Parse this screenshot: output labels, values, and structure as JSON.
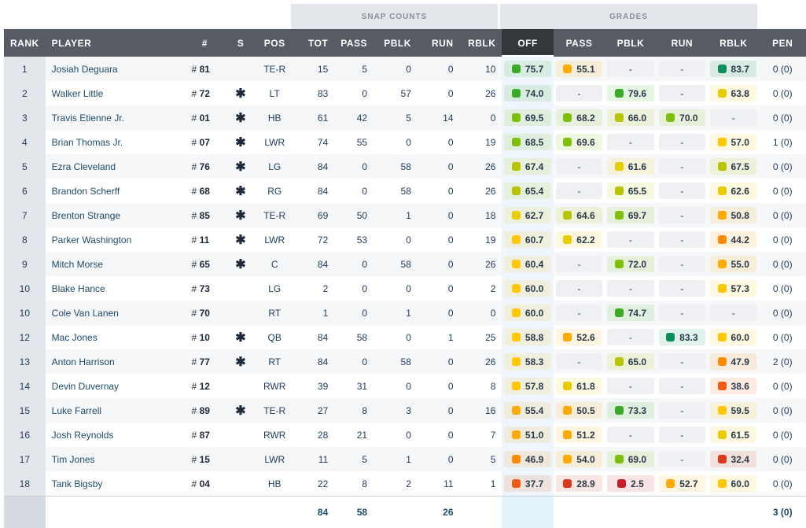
{
  "groups": {
    "snap_counts": "SNAP COUNTS",
    "grades": "GRADES"
  },
  "columns": {
    "rank": "RANK",
    "player": "PLAYER",
    "number": "#",
    "starter": "S",
    "pos": "POS",
    "tot": "TOT",
    "pass": "PASS",
    "pblk": "PBLK",
    "run": "RUN",
    "rblk": "RBLK",
    "g_off": "OFF",
    "g_pass": "PASS",
    "g_pblk": "PBLK",
    "g_run": "RUN",
    "g_rblk": "RBLK",
    "pen": "PEN"
  },
  "grade_colors": {
    "dark_green": "#0a8f5a",
    "green": "#3aab25",
    "lime": "#7dbf0a",
    "yellow_green": "#b9c400",
    "yellow": "#e8cc00",
    "gold": "#ffc800",
    "amber": "#ffaa00",
    "orange": "#ff8a00",
    "red_orange": "#f15a10",
    "red": "#d83a1a",
    "dark_red": "#c81e2a"
  },
  "rows": [
    {
      "rank": "1",
      "player": "Josiah Deguara",
      "num_prefix": "# ",
      "num": "81",
      "s": "",
      "pos": "TE-R",
      "tot": "15",
      "pass": "5",
      "pblk": "0",
      "run": "0",
      "rblk": "10",
      "off": "75.7",
      "g_pass": "55.1",
      "g_pblk": "-",
      "g_run": "-",
      "g_rblk": "83.7",
      "pen": "0 (0)"
    },
    {
      "rank": "2",
      "player": "Walker Little",
      "num_prefix": "# ",
      "num": "72",
      "s": "✱",
      "pos": "LT",
      "tot": "83",
      "pass": "0",
      "pblk": "57",
      "run": "0",
      "rblk": "26",
      "off": "74.0",
      "g_pass": "-",
      "g_pblk": "79.6",
      "g_run": "-",
      "g_rblk": "63.8",
      "pen": "0 (0)"
    },
    {
      "rank": "3",
      "player": "Travis Etienne Jr.",
      "num_prefix": "# ",
      "num": "01",
      "s": "✱",
      "pos": "HB",
      "tot": "61",
      "pass": "42",
      "pblk": "5",
      "run": "14",
      "rblk": "0",
      "off": "69.5",
      "g_pass": "68.2",
      "g_pblk": "66.0",
      "g_run": "70.0",
      "g_rblk": "-",
      "pen": "0 (0)"
    },
    {
      "rank": "4",
      "player": "Brian Thomas Jr.",
      "num_prefix": "# ",
      "num": "07",
      "s": "✱",
      "pos": "LWR",
      "tot": "74",
      "pass": "55",
      "pblk": "0",
      "run": "0",
      "rblk": "19",
      "off": "68.5",
      "g_pass": "69.6",
      "g_pblk": "-",
      "g_run": "-",
      "g_rblk": "57.0",
      "pen": "1 (0)"
    },
    {
      "rank": "5",
      "player": "Ezra Cleveland",
      "num_prefix": "# ",
      "num": "76",
      "s": "✱",
      "pos": "LG",
      "tot": "84",
      "pass": "0",
      "pblk": "58",
      "run": "0",
      "rblk": "26",
      "off": "67.4",
      "g_pass": "-",
      "g_pblk": "61.6",
      "g_run": "-",
      "g_rblk": "67.5",
      "pen": "0 (0)"
    },
    {
      "rank": "6",
      "player": "Brandon Scherff",
      "num_prefix": "# ",
      "num": "68",
      "s": "✱",
      "pos": "RG",
      "tot": "84",
      "pass": "0",
      "pblk": "58",
      "run": "0",
      "rblk": "26",
      "off": "65.4",
      "g_pass": "-",
      "g_pblk": "65.5",
      "g_run": "-",
      "g_rblk": "62.6",
      "pen": "0 (0)"
    },
    {
      "rank": "7",
      "player": "Brenton Strange",
      "num_prefix": "# ",
      "num": "85",
      "s": "✱",
      "pos": "TE-R",
      "tot": "69",
      "pass": "50",
      "pblk": "1",
      "run": "0",
      "rblk": "18",
      "off": "62.7",
      "g_pass": "64.6",
      "g_pblk": "69.7",
      "g_run": "-",
      "g_rblk": "50.8",
      "pen": "0 (0)"
    },
    {
      "rank": "8",
      "player": "Parker Washington",
      "num_prefix": "# ",
      "num": "11",
      "s": "✱",
      "pos": "LWR",
      "tot": "72",
      "pass": "53",
      "pblk": "0",
      "run": "0",
      "rblk": "19",
      "off": "60.7",
      "g_pass": "62.2",
      "g_pblk": "-",
      "g_run": "-",
      "g_rblk": "44.2",
      "pen": "0 (0)"
    },
    {
      "rank": "9",
      "player": "Mitch Morse",
      "num_prefix": "# ",
      "num": "65",
      "s": "✱",
      "pos": "C",
      "tot": "84",
      "pass": "0",
      "pblk": "58",
      "run": "0",
      "rblk": "26",
      "off": "60.4",
      "g_pass": "-",
      "g_pblk": "72.0",
      "g_run": "-",
      "g_rblk": "55.0",
      "pen": "0 (0)"
    },
    {
      "rank": "10",
      "player": "Blake Hance",
      "num_prefix": "# ",
      "num": "73",
      "s": "",
      "pos": "LG",
      "tot": "2",
      "pass": "0",
      "pblk": "0",
      "run": "0",
      "rblk": "2",
      "off": "60.0",
      "g_pass": "-",
      "g_pblk": "-",
      "g_run": "-",
      "g_rblk": "57.3",
      "pen": "0 (0)"
    },
    {
      "rank": "10",
      "player": "Cole Van Lanen",
      "num_prefix": "# ",
      "num": "70",
      "s": "",
      "pos": "RT",
      "tot": "1",
      "pass": "0",
      "pblk": "1",
      "run": "0",
      "rblk": "0",
      "off": "60.0",
      "g_pass": "-",
      "g_pblk": "74.7",
      "g_run": "-",
      "g_rblk": "-",
      "pen": "0 (0)"
    },
    {
      "rank": "12",
      "player": "Mac Jones",
      "num_prefix": "# ",
      "num": "10",
      "s": "✱",
      "pos": "QB",
      "tot": "84",
      "pass": "58",
      "pblk": "0",
      "run": "1",
      "rblk": "25",
      "off": "58.8",
      "g_pass": "52.6",
      "g_pblk": "-",
      "g_run": "83.3",
      "g_rblk": "60.0",
      "pen": "0 (0)"
    },
    {
      "rank": "13",
      "player": "Anton Harrison",
      "num_prefix": "# ",
      "num": "77",
      "s": "✱",
      "pos": "RT",
      "tot": "84",
      "pass": "0",
      "pblk": "58",
      "run": "0",
      "rblk": "26",
      "off": "58.3",
      "g_pass": "-",
      "g_pblk": "65.0",
      "g_run": "-",
      "g_rblk": "47.9",
      "pen": "2 (0)"
    },
    {
      "rank": "14",
      "player": "Devin Duvernay",
      "num_prefix": "# ",
      "num": "12",
      "s": "",
      "pos": "RWR",
      "tot": "39",
      "pass": "31",
      "pblk": "0",
      "run": "0",
      "rblk": "8",
      "off": "57.8",
      "g_pass": "61.8",
      "g_pblk": "-",
      "g_run": "-",
      "g_rblk": "38.6",
      "pen": "0 (0)"
    },
    {
      "rank": "15",
      "player": "Luke Farrell",
      "num_prefix": "# ",
      "num": "89",
      "s": "✱",
      "pos": "TE-R",
      "tot": "27",
      "pass": "8",
      "pblk": "3",
      "run": "0",
      "rblk": "16",
      "off": "55.4",
      "g_pass": "50.5",
      "g_pblk": "73.3",
      "g_run": "-",
      "g_rblk": "59.5",
      "pen": "0 (0)"
    },
    {
      "rank": "16",
      "player": "Josh Reynolds",
      "num_prefix": "# ",
      "num": "87",
      "s": "",
      "pos": "RWR",
      "tot": "28",
      "pass": "21",
      "pblk": "0",
      "run": "0",
      "rblk": "7",
      "off": "51.0",
      "g_pass": "51.2",
      "g_pblk": "-",
      "g_run": "-",
      "g_rblk": "61.5",
      "pen": "0 (0)"
    },
    {
      "rank": "17",
      "player": "Tim Jones",
      "num_prefix": "# ",
      "num": "15",
      "s": "",
      "pos": "LWR",
      "tot": "11",
      "pass": "5",
      "pblk": "1",
      "run": "0",
      "rblk": "5",
      "off": "46.9",
      "g_pass": "54.0",
      "g_pblk": "69.0",
      "g_run": "-",
      "g_rblk": "32.4",
      "pen": "0 (0)"
    },
    {
      "rank": "18",
      "player": "Tank Bigsby",
      "num_prefix": "# ",
      "num": "04",
      "s": "",
      "pos": "HB",
      "tot": "22",
      "pass": "8",
      "pblk": "2",
      "run": "11",
      "rblk": "1",
      "off": "37.7",
      "g_pass": "28.9",
      "g_pblk": "2.5",
      "g_run": "52.7",
      "g_rblk": "60.0",
      "pen": "0 (0)"
    }
  ],
  "totals": {
    "tot": "84",
    "pass": "58",
    "pblk": "",
    "run": "26",
    "rblk": "",
    "pen": "3 (0)"
  }
}
